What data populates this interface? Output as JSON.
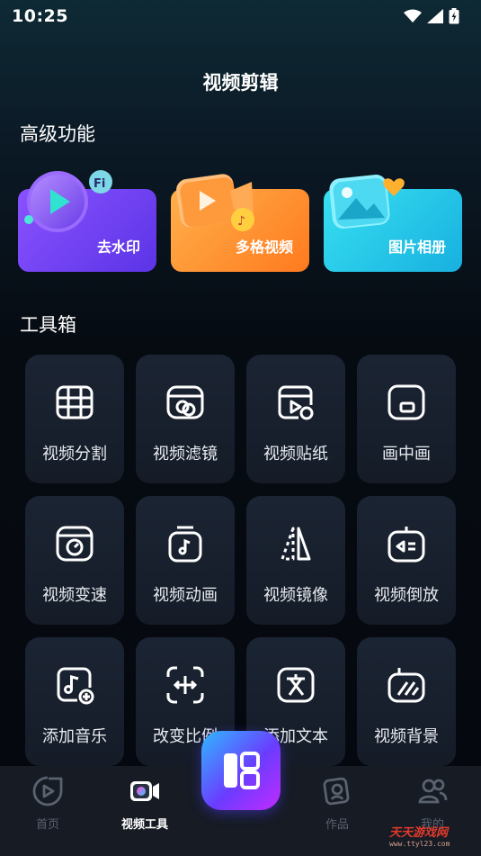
{
  "status_bar": {
    "time": "10:25"
  },
  "header": {
    "title": "视频剪辑"
  },
  "premium": {
    "title": "高级功能",
    "cards": [
      {
        "label": "去水印",
        "icon": "play-bubble-icon"
      },
      {
        "label": "多格视频",
        "icon": "video-camera-icon"
      },
      {
        "label": "图片相册",
        "icon": "photo-album-icon"
      }
    ]
  },
  "toolbox": {
    "title": "工具箱",
    "tools": [
      {
        "label": "视频分割",
        "icon": "film-split-icon"
      },
      {
        "label": "视频滤镜",
        "icon": "filter-icon"
      },
      {
        "label": "视频贴纸",
        "icon": "sticker-icon"
      },
      {
        "label": "画中画",
        "icon": "picture-in-picture-icon"
      },
      {
        "label": "视频变速",
        "icon": "speed-icon"
      },
      {
        "label": "视频动画",
        "icon": "animation-icon"
      },
      {
        "label": "视频镜像",
        "icon": "mirror-icon"
      },
      {
        "label": "视频倒放",
        "icon": "reverse-icon"
      },
      {
        "label": "添加音乐",
        "icon": "add-music-icon"
      },
      {
        "label": "改变比例",
        "icon": "aspect-ratio-icon"
      },
      {
        "label": "添加文本",
        "icon": "add-text-icon"
      },
      {
        "label": "视频背景",
        "icon": "background-icon"
      }
    ]
  },
  "tab_bar": {
    "tabs": [
      {
        "label": "首页",
        "icon": "home-play-icon",
        "active": false
      },
      {
        "label": "视频工具",
        "icon": "video-tool-icon",
        "active": true
      },
      {
        "label": "作品",
        "icon": "works-icon",
        "active": false
      },
      {
        "label": "我的",
        "icon": "profile-icon",
        "active": false
      }
    ]
  },
  "watermark": {
    "text": "天天游戏网",
    "url": "www.ttyl23.com"
  },
  "colors": {
    "card_purple": "#6c3cf0",
    "card_orange": "#ff8a2a",
    "card_cyan": "#22c8e8",
    "accent_active": "#ffffff"
  }
}
